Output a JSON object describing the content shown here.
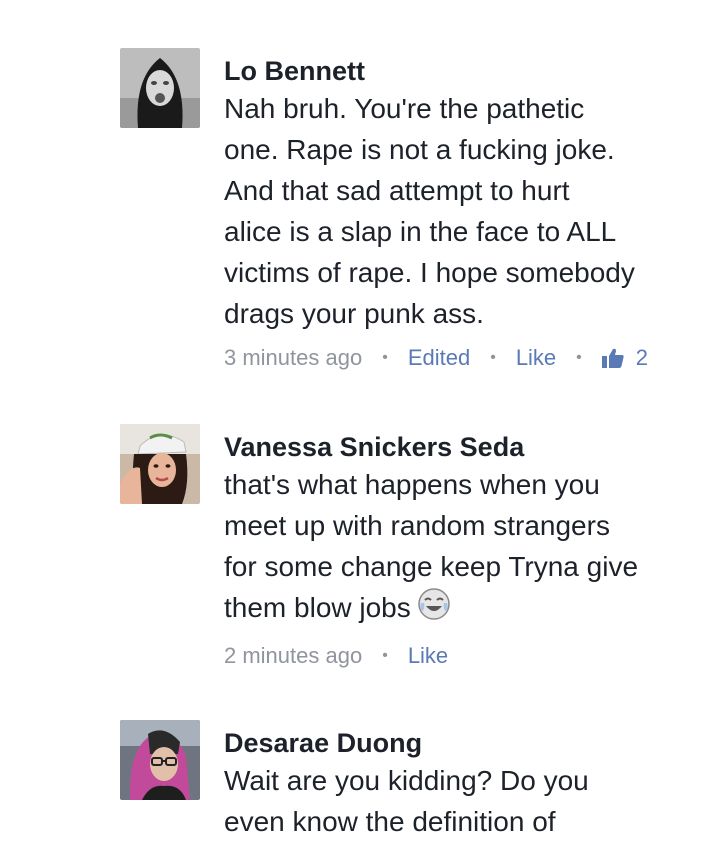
{
  "comments": [
    {
      "author": "Lo Bennett",
      "lines": [
        "Nah bruh. You're the pathetic",
        "one. Rape is not a fucking joke.",
        "And that sad attempt to hurt",
        "alice is a slap in the face to ALL",
        "victims of rape. I hope somebody",
        "drags your punk ass."
      ],
      "time": "3 minutes ago",
      "edited": "Edited",
      "like": "Like",
      "like_count": "2"
    },
    {
      "author": "Vanessa Snickers Seda",
      "lines": [
        "that's what happens when you",
        "meet up with random strangers",
        "for some change keep Tryna give",
        "them blow jobs"
      ],
      "emoji": "face-with-tears-of-joy-icon",
      "time": "2 minutes ago",
      "like": "Like"
    },
    {
      "author": "Desarae Duong",
      "lines": [
        "Wait are you kidding? Do you",
        "even know the definition of"
      ]
    }
  ],
  "colors": {
    "name": "#1d2129",
    "meta": "#90949c",
    "link": "#5a7ab6"
  }
}
